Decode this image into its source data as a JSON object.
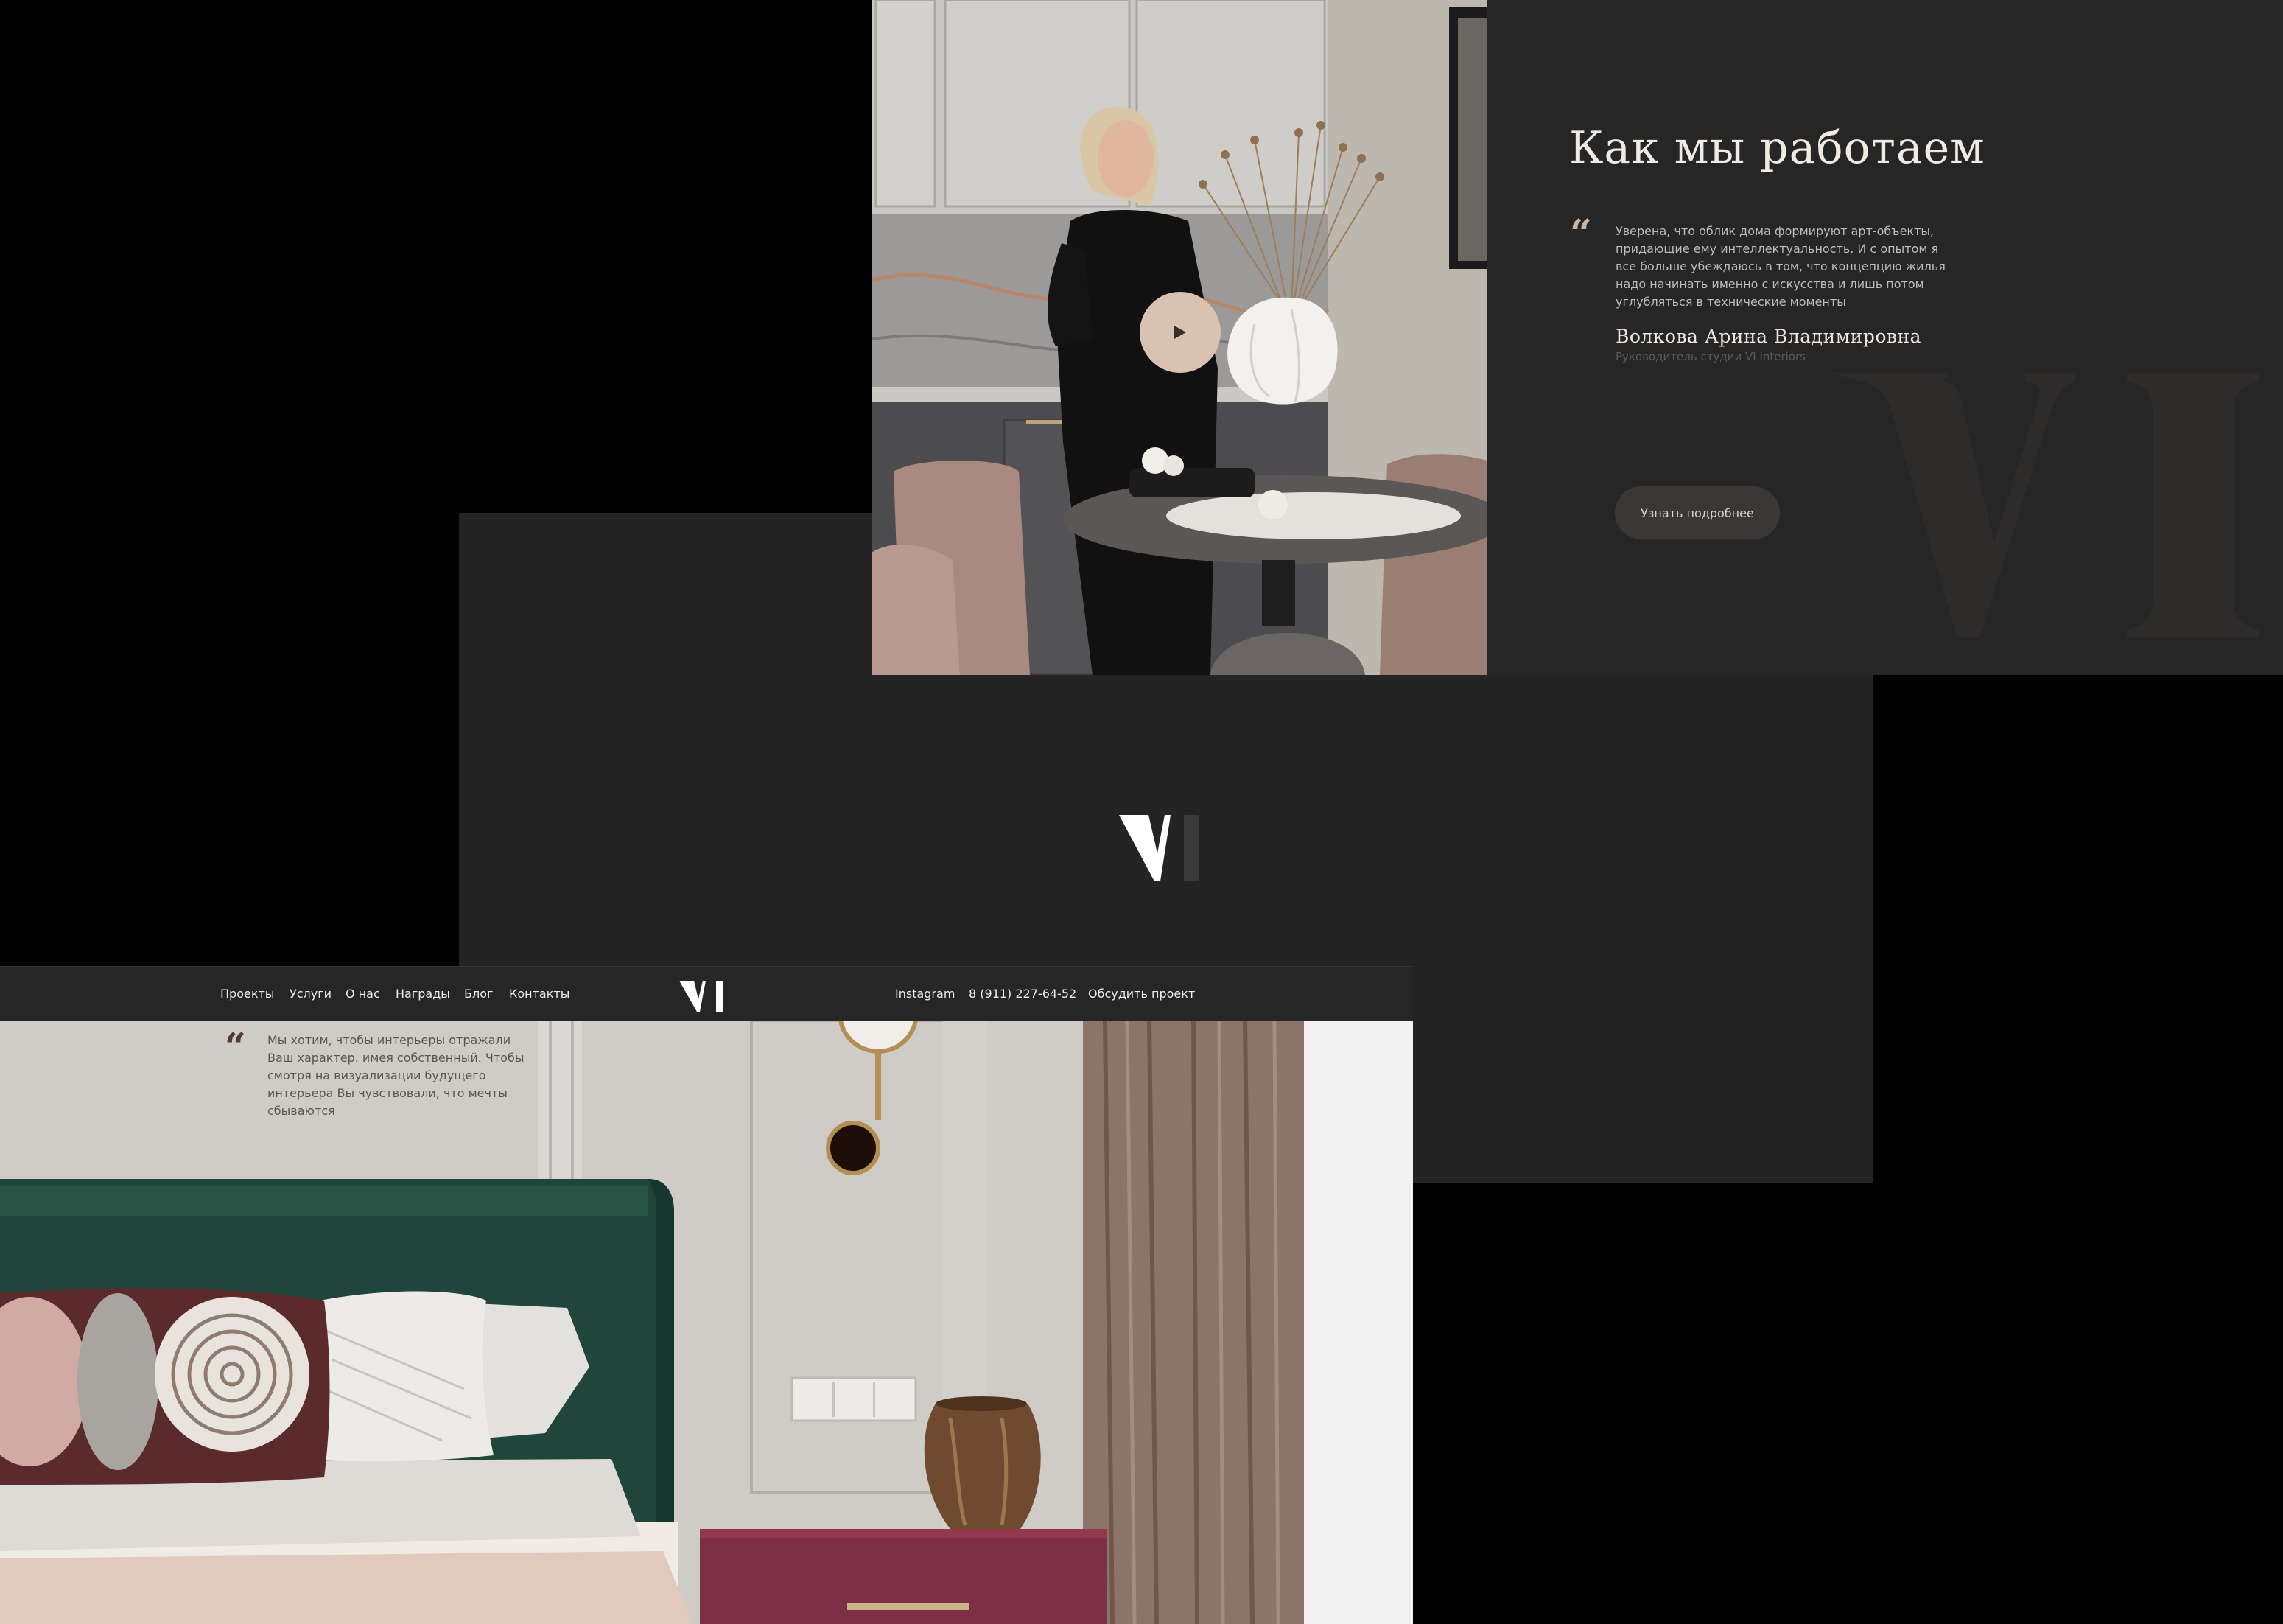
{
  "how_we_work": {
    "title": "Как мы работаем",
    "quote": "Уверена, что облик дома формируют арт-объекты, придающие ему интеллектуальность. И с опытом я все больше убеждаюсь в том, что концепцию жилья надо начинать именно с искусства и лишь потом углубляться в технические моменты",
    "author_name": "Волкова Арина Владимировна",
    "author_role": "Руководитель студии VI Interiors",
    "more_button": "Узнать подробнее",
    "play_icon": "play-icon"
  },
  "nav": {
    "links": [
      "Проекты",
      "Услуги",
      "О нас",
      "Награды",
      "Блог",
      "Контакты"
    ],
    "instagram": "Instagram",
    "phone": "8 (911) 227-64-52",
    "cta": "Обсудить проект"
  },
  "hero": {
    "quote": "Мы хотим, чтобы интерьеры отражали Ваш характер. имея собственный. Чтобы смотря на визуализации будущего интерьера Вы чувствовали, что мечты сбываются"
  },
  "colors": {
    "panel_dark": "#262626",
    "accent_beige": "#cdb4a1",
    "text_light": "#efeae4",
    "background": "#000000"
  }
}
